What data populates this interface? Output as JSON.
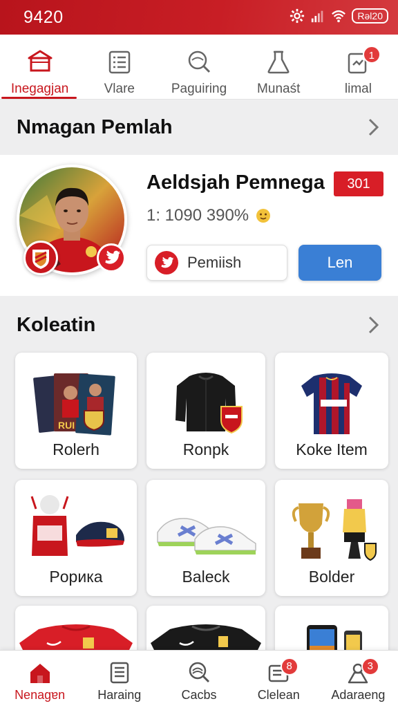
{
  "status_bar": {
    "time": "9420",
    "battery_label": "Rəl20"
  },
  "top_tabs": [
    {
      "label": "Inegagjan",
      "icon": "shop-icon",
      "active": true
    },
    {
      "label": "Vlare",
      "icon": "list-icon",
      "active": false
    },
    {
      "label": "Paguiring",
      "icon": "search-icon",
      "active": false
    },
    {
      "label": "Munaśt",
      "icon": "flask-icon",
      "active": false
    },
    {
      "label": "limal",
      "icon": "clipboard-icon",
      "active": false,
      "badge": "1"
    }
  ],
  "header": {
    "title": "Nmagan Pemlah"
  },
  "profile": {
    "name": "Aeldsjah Pemnega",
    "badge": "301",
    "stat": "1: 1090 390%",
    "follow_label": "Pemiish",
    "primary_label": "Len"
  },
  "collection": {
    "title": "Koleatin",
    "items": [
      {
        "label": "Rolerh",
        "icon": "trading-cards-icon"
      },
      {
        "label": "Ronpk",
        "icon": "jacket-icon"
      },
      {
        "label": "Koke Item",
        "icon": "jersey-icon"
      },
      {
        "label": "Popика",
        "icon": "mascot-cap-icon"
      },
      {
        "label": "Baleck",
        "icon": "sneakers-icon"
      },
      {
        "label": "Bolder",
        "icon": "trophy-icon"
      },
      {
        "label": "",
        "icon": "red-shirt-icon"
      },
      {
        "label": "",
        "icon": "black-shirt-icon"
      },
      {
        "label": "",
        "icon": "phone-icon"
      }
    ]
  },
  "bottom_nav": [
    {
      "label": "Nenagɐn",
      "icon": "home-icon",
      "active": true
    },
    {
      "label": "Haraing",
      "icon": "news-icon",
      "active": false
    },
    {
      "label": "Cacbs",
      "icon": "search-icon",
      "active": false
    },
    {
      "label": "Clelean",
      "icon": "cards-icon",
      "active": false,
      "badge": "8"
    },
    {
      "label": "Adaraeng",
      "icon": "profile-icon",
      "active": false,
      "badge": "3"
    }
  ],
  "colors": {
    "brand_red": "#c8161d",
    "primary_blue": "#3a7fd5"
  }
}
